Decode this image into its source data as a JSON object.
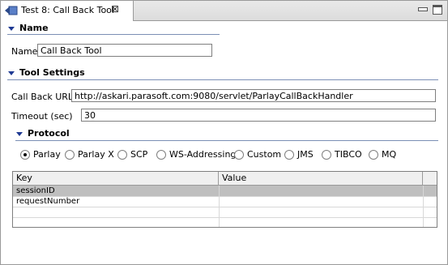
{
  "tab": {
    "title": "Test 8: Call Back Tool",
    "close_glyph": "⊠"
  },
  "sections": {
    "name": {
      "title": "Name"
    },
    "tool_settings": {
      "title": "Tool Settings"
    },
    "protocol": {
      "title": "Protocol"
    }
  },
  "fields": {
    "name": {
      "label": "Name",
      "value": "Call Back Tool"
    },
    "callback_url": {
      "label": "Call Back URL",
      "value": "http://askari.parasoft.com:9080/servlet/ParlayCallBackHandler"
    },
    "timeout": {
      "label": "Timeout (sec)",
      "value": "30"
    }
  },
  "protocol_options": [
    {
      "label": "Parlay",
      "selected": true
    },
    {
      "label": "Parlay X",
      "selected": false
    },
    {
      "label": "SCP",
      "selected": false
    },
    {
      "label": "WS-Addressing",
      "selected": false
    },
    {
      "label": "Custom",
      "selected": false
    },
    {
      "label": "JMS",
      "selected": false
    },
    {
      "label": "TIBCO",
      "selected": false
    },
    {
      "label": "MQ",
      "selected": false
    }
  ],
  "table": {
    "columns": [
      "Key",
      "Value"
    ],
    "rows": [
      {
        "key": "sessionID",
        "value": "",
        "selected": true
      },
      {
        "key": "requestNumber",
        "value": "",
        "selected": false
      },
      {
        "key": "",
        "value": "",
        "selected": false
      },
      {
        "key": "",
        "value": "",
        "selected": false
      }
    ]
  },
  "colors": {
    "section_arrow": "#1f3a93",
    "selected_row": "#bfbfbf"
  }
}
